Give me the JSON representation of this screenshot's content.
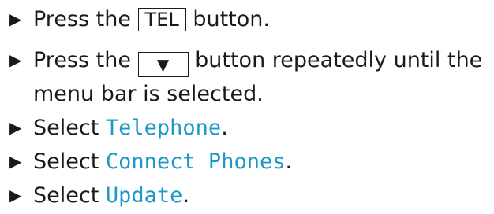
{
  "accent_color": "#1e98c6",
  "steps": [
    {
      "arrow": "▶",
      "pre": "Press the ",
      "key": "TEL",
      "post": " button."
    },
    {
      "arrow": "▶",
      "pre": "Press the ",
      "key": "▼",
      "post": " button repeatedly until the",
      "cont": "menu bar is selected."
    },
    {
      "arrow": "▶",
      "pre": "Select ",
      "item": "Telephone",
      "post": "."
    },
    {
      "arrow": "▶",
      "pre": "Select ",
      "item": "Connect Phones",
      "post": "."
    },
    {
      "arrow": "▶",
      "pre": "Select ",
      "item": "Update",
      "post": "."
    }
  ]
}
